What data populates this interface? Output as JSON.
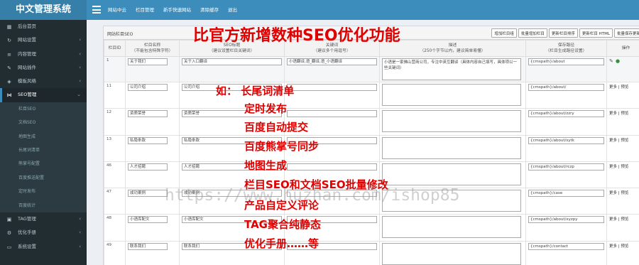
{
  "app": {
    "brand": "中文管理系统"
  },
  "top_nav": [
    "网站中云",
    "栏目管理",
    "新手快速网站",
    "清除缓存",
    "退出"
  ],
  "sidebar": {
    "items": [
      {
        "label": "后台首页",
        "icon": "dashboard-icon",
        "arrow": false
      },
      {
        "label": "网站设置",
        "icon": "refresh-icon",
        "arrow": true
      },
      {
        "label": "内容管理",
        "icon": "list-icon",
        "arrow": true
      },
      {
        "label": "网站插件",
        "icon": "plug-icon",
        "arrow": true
      },
      {
        "label": "模板风格",
        "icon": "palette-icon",
        "arrow": true
      },
      {
        "label": "SEO管理",
        "icon": "share-icon",
        "arrow": true,
        "active": true
      }
    ],
    "sub_items": [
      "栏目SEO",
      "文档SEO",
      "地图生成",
      "长尾词清单",
      "熊掌号配置",
      "百度推送配置",
      "定时发布",
      "百度统计"
    ],
    "bottom_items": [
      {
        "label": "TAG管理",
        "icon": "tag-icon",
        "arrow": true
      },
      {
        "label": "优化手册",
        "icon": "gear-icon",
        "arrow": true
      },
      {
        "label": "系统设置",
        "icon": "monitor-icon",
        "arrow": true
      }
    ]
  },
  "panel": {
    "title": "网站栏目SEO",
    "buttons": [
      "增加栏目组",
      "批量增加栏目",
      "更新栏目排序",
      "更新栏目 HTML",
      "批量保存更新"
    ]
  },
  "table": {
    "headers": [
      {
        "line1": "栏目ID",
        "line2": ""
      },
      {
        "line1": "栏目名称",
        "line2": "（不能包含特殊字符）"
      },
      {
        "line1": "SEO标题",
        "line2": "（建议设置栏目关键词）"
      },
      {
        "line1": "关键词",
        "line2": "（建议多个用逗号）"
      },
      {
        "line1": "描述",
        "line2": "（250个字节以内，建议简单易懂）"
      },
      {
        "line1": "保存路径",
        "line2": "（栏目生成路径设置）"
      },
      {
        "line1": "操作",
        "line2": ""
      }
    ],
    "rows": [
      {
        "id": "1",
        "name": "关于我们",
        "seo_title": "关于入口翻译",
        "keywords": "小语翻译,语_翻译,语_小语翻译",
        "description": "小语是一家佛山营商公司，专注中英互翻译（具体内容自己填写，具体项以一些关键词）",
        "path": "{cmspath}/about",
        "ops": ""
      },
      {
        "id": "11",
        "name": "公司介绍",
        "seo_title": "公司介绍",
        "keywords": "",
        "description": "",
        "path": "{cmspath}/about/",
        "ops": "更多 | 预览"
      },
      {
        "id": "12",
        "name": "资质荣誉",
        "seo_title": "资质荣誉",
        "keywords": "",
        "description": "",
        "path": "{cmspath}/about/zzry",
        "ops": "更多 | 预览"
      },
      {
        "id": "13",
        "name": "私隐条款",
        "seo_title": "私隐条款",
        "keywords": "",
        "description": "",
        "path": "{cmspath}/about/sytk",
        "ops": "更多 | 预览"
      },
      {
        "id": "46",
        "name": "人才招聘",
        "seo_title": "人才招聘",
        "keywords": "",
        "description": "",
        "path": "{cmspath}/about/rczp",
        "ops": "更多 | 预览"
      },
      {
        "id": "47",
        "name": "成功案例",
        "seo_title": "成功案例",
        "keywords": "",
        "description": "",
        "path": "{cmspath}/case",
        "ops": "更多 | 预览"
      },
      {
        "id": "48",
        "name": "小语库配文",
        "seo_title": "小语库配文",
        "keywords": "",
        "description": "",
        "path": "{cmspath}/about/xyzpy",
        "ops": "更多 | 预览"
      },
      {
        "id": "49",
        "name": "联系我们",
        "seo_title": "联系我们",
        "keywords": "",
        "description": "",
        "path": "{cmspath}/contact",
        "ops": "更多 | 预览"
      }
    ]
  },
  "overlay": {
    "headline": "比官方新增数种SEO优化功能",
    "features": [
      "如：  长尾词清单",
      "定时发布",
      "百度自动提交",
      "百度熊掌号同步",
      "地图生成",
      "栏目SEO和文档SEO批量修改",
      "产品自定义评论",
      "TAG聚合纯静态",
      "优化手册……等"
    ],
    "watermark": "https://www.huzhan.com/ishop85"
  },
  "colors": {
    "topbar": "#3c8dbc",
    "sidebar": "#222d32",
    "overlay_red": "#e00000"
  }
}
